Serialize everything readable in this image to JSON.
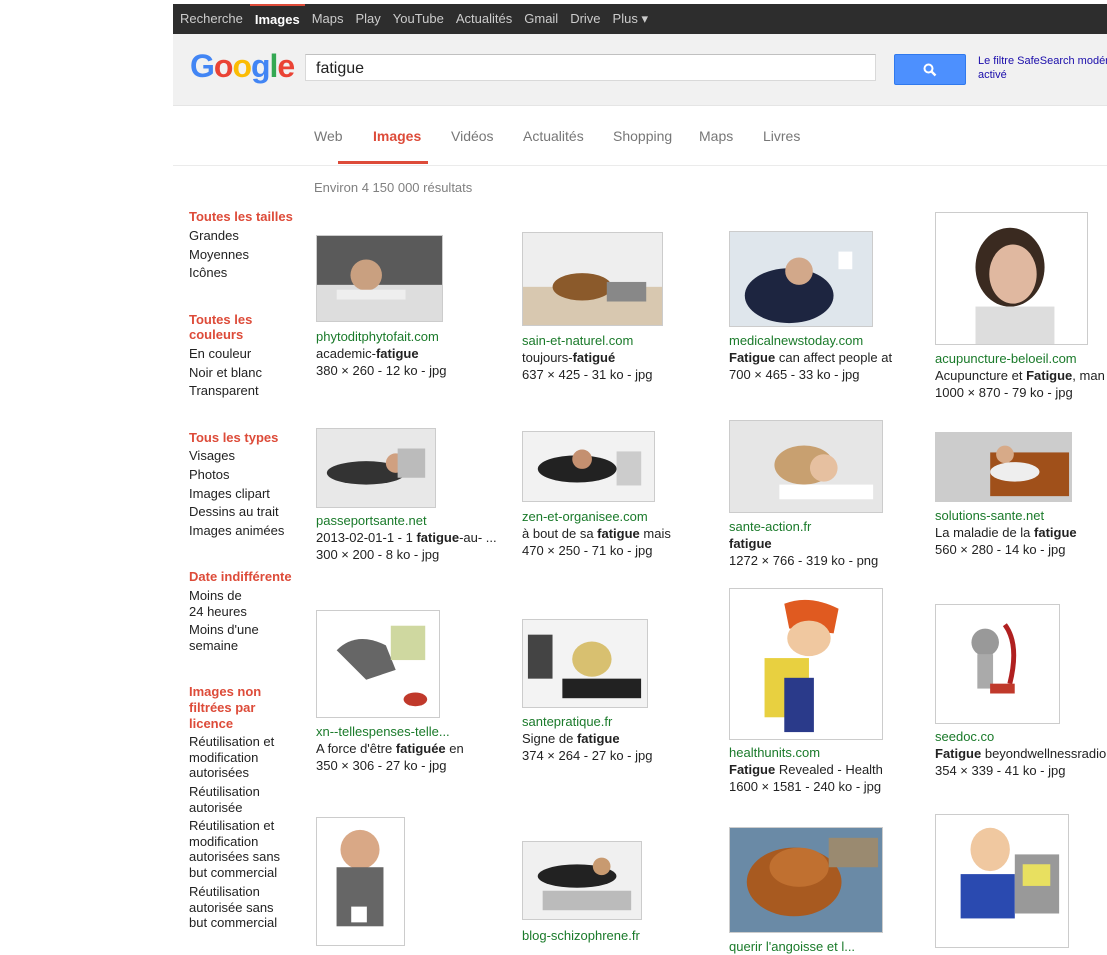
{
  "topbar": {
    "items": [
      "Recherche",
      "Images",
      "Maps",
      "Play",
      "YouTube",
      "Actualités",
      "Gmail",
      "Drive",
      "Plus ▾"
    ],
    "active_index": 1
  },
  "header": {
    "logo": "Google",
    "search_value": "fatigue",
    "safesearch_line1": "Le filtre SafeSearch modéré",
    "safesearch_line2": "activé"
  },
  "tabs": {
    "items": [
      "Web",
      "Images",
      "Vidéos",
      "Actualités",
      "Shopping",
      "Maps",
      "Livres"
    ],
    "active_index": 1
  },
  "results_count": "Environ 4 150 000 résultats",
  "sidebar": {
    "groups": [
      {
        "head": "Toutes les tailles",
        "items": [
          "Grandes",
          "Moyennes",
          "Icônes"
        ]
      },
      {
        "head": "Toutes les couleurs",
        "items": [
          "En couleur",
          "Noir et blanc",
          "Transparent"
        ]
      },
      {
        "head": "Tous les types",
        "items": [
          "Visages",
          "Photos",
          "Images clipart",
          "Dessins au trait",
          "Images animées"
        ]
      },
      {
        "head": "Date indifférente",
        "items": [
          "Moins de 24 heures",
          "Moins d'une semaine"
        ]
      },
      {
        "head": "Images non filtrées par licence",
        "items": [
          "Réutilisation et modification autorisées",
          "Réutilisation autorisée",
          "Réutilisation et modification autorisées sans but commercial",
          "Réutilisation autorisée sans but commercial"
        ]
      }
    ]
  },
  "results": [
    {
      "domain": "phytoditphytofait.com",
      "title_pre": "academic-",
      "title_bold": "fatigue",
      "title_post": "",
      "size": "380 × 260 - 12 ko - jpg"
    },
    {
      "domain": "sain-et-naturel.com",
      "title_pre": "toujours-",
      "title_bold": "fatigué",
      "title_post": "",
      "size": "637 × 425 - 31 ko - jpg"
    },
    {
      "domain": "medicalnewstoday.com",
      "title_pre": "",
      "title_bold": "Fatigue",
      "title_post": " can affect people at",
      "size": "700 × 465 - 33 ko - jpg"
    },
    {
      "domain": "acupuncture-beloeil.com",
      "title_pre": "Acupuncture et ",
      "title_bold": "Fatigue",
      "title_post": ", man",
      "size": "1000 × 870 - 79 ko - jpg"
    },
    {
      "domain": "passeportsante.net",
      "title_pre": "2013-02-01-1 - 1 ",
      "title_bold": "fatigue",
      "title_post": "-au- ...",
      "size": "300 × 200 - 8 ko - jpg"
    },
    {
      "domain": "zen-et-organisee.com",
      "title_pre": "à bout de sa ",
      "title_bold": "fatigue",
      "title_post": " mais",
      "size": "470 × 250 - 71 ko - jpg"
    },
    {
      "domain": "sante-action.fr",
      "title_pre": "",
      "title_bold": "fatigue",
      "title_post": "",
      "size": "1272 × 766 - 319 ko - png"
    },
    {
      "domain": "solutions-sante.net",
      "title_pre": "La maladie de la ",
      "title_bold": "fatigue",
      "title_post": "",
      "size": "560 × 280 - 14 ko - jpg"
    },
    {
      "domain": "xn--tellespenses-telle...",
      "title_pre": "A force d'être ",
      "title_bold": "fatiguée",
      "title_post": " en",
      "size": "350 × 306 - 27 ko - jpg"
    },
    {
      "domain": "santepratique.fr",
      "title_pre": "Signe de ",
      "title_bold": "fatigue",
      "title_post": "",
      "size": "374 × 264 - 27 ko - jpg"
    },
    {
      "domain": "healthunits.com",
      "title_pre": "",
      "title_bold": "Fatigue",
      "title_post": " Revealed - Health",
      "size": "1600 × 1581 - 240 ko - jpg"
    },
    {
      "domain": "seedoc.co",
      "title_pre": "",
      "title_bold": "Fatigue",
      "title_post": " beyondwellnessradio",
      "size": "354 × 339 - 41 ko - jpg"
    },
    {
      "domain": "",
      "title_pre": "",
      "title_bold": "",
      "title_post": "",
      "size": ""
    },
    {
      "domain": "blog-schizophrene.fr",
      "title_pre": "",
      "title_bold": "",
      "title_post": "",
      "size": ""
    },
    {
      "domain": "querir l'angoisse et l...",
      "title_pre": "",
      "title_bold": "",
      "title_post": "",
      "size": ""
    },
    {
      "domain": "",
      "title_pre": "",
      "title_bold": "",
      "title_post": "",
      "size": ""
    }
  ],
  "colors": {
    "accent": "#dd4b39",
    "link_green": "#1a7a2a",
    "search_blue": "#4d90fe"
  }
}
